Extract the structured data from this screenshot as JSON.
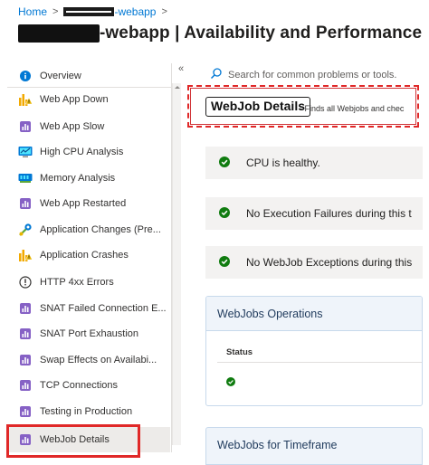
{
  "breadcrumb": {
    "home": "Home",
    "resource_suffix": "-webapp"
  },
  "page": {
    "title_suffix": "-webapp | Availability and Performance"
  },
  "sidebar": {
    "items": [
      {
        "label": "Overview",
        "icon": "info-icon"
      },
      {
        "label": "Web App Down",
        "icon": "chart-warning-icon"
      },
      {
        "label": "Web App Slow",
        "icon": "detector-icon"
      },
      {
        "label": "High CPU Analysis",
        "icon": "cpu-icon"
      },
      {
        "label": "Memory Analysis",
        "icon": "memory-icon"
      },
      {
        "label": "Web App Restarted",
        "icon": "detector-icon"
      },
      {
        "label": "Application Changes (Pre...",
        "icon": "changes-icon"
      },
      {
        "label": "Application Crashes",
        "icon": "chart-warning-icon"
      },
      {
        "label": "HTTP 4xx Errors",
        "icon": "error-circle-icon"
      },
      {
        "label": "SNAT Failed Connection E...",
        "icon": "detector-icon"
      },
      {
        "label": "SNAT Port Exhaustion",
        "icon": "detector-icon"
      },
      {
        "label": "Swap Effects on Availabi...",
        "icon": "detector-icon"
      },
      {
        "label": "TCP Connections",
        "icon": "detector-icon"
      },
      {
        "label": "Testing in Production",
        "icon": "detector-icon"
      },
      {
        "label": "WebJob Details",
        "icon": "detector-icon"
      }
    ],
    "selected": "WebJob Details",
    "collapse_glyph": "«"
  },
  "search": {
    "placeholder": "Search for common problems or tools."
  },
  "detector": {
    "name": "WebJob Details",
    "description": "- Finds all Webjobs and chec"
  },
  "checks": [
    {
      "text": "CPU is healthy.",
      "status": "success"
    },
    {
      "text": "No Execution Failures during this t",
      "status": "success"
    },
    {
      "text": "No WebJob Exceptions during this",
      "status": "success"
    }
  ],
  "operations": {
    "title": "WebJobs Operations",
    "column": "Status",
    "row_status": "success"
  },
  "timeframe": {
    "title": "WebJobs for Timeframe"
  },
  "colors": {
    "accent": "#0078d4",
    "success": "#107c10",
    "highlight": "#e02828"
  }
}
